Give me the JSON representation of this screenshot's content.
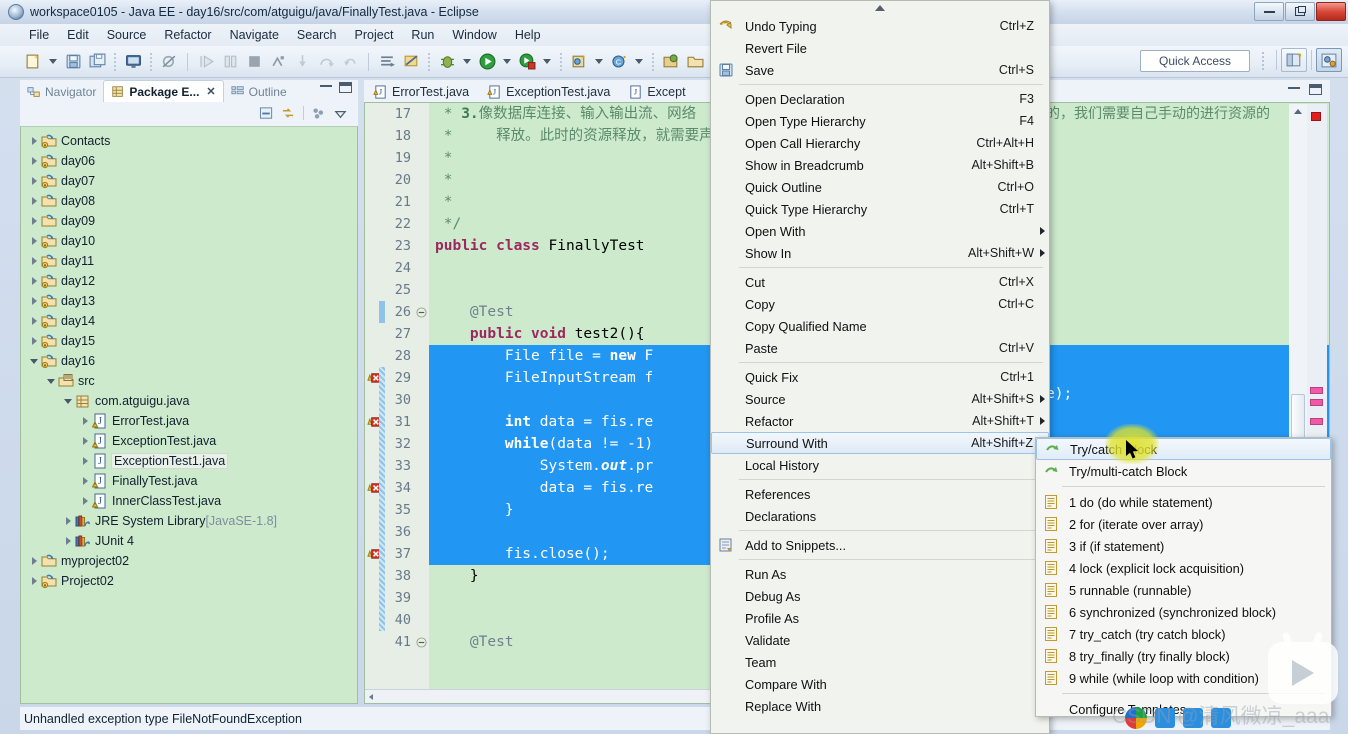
{
  "window": {
    "title": "workspace0105 - Java EE - day16/src/com/atguigu/java/FinallyTest.java - Eclipse",
    "icon": "eclipse-icon",
    "controls": {
      "minimize": "minimize-button",
      "maximize": "maximize-button",
      "close": "close-button"
    }
  },
  "menubar": {
    "items": [
      "File",
      "Edit",
      "Source",
      "Refactor",
      "Navigate",
      "Search",
      "Project",
      "Run",
      "Window",
      "Help"
    ]
  },
  "toolbar": {
    "quick_access_placeholder": "Quick Access",
    "quick_access_value": "Quick Access"
  },
  "left_view": {
    "tabs": [
      {
        "label": "Navigator",
        "icon": "navigator-icon",
        "active": false,
        "closable": false
      },
      {
        "label": "Package E...",
        "icon": "package-explorer-icon",
        "active": true,
        "closable": true
      },
      {
        "label": "Outline",
        "icon": "outline-icon",
        "active": false,
        "closable": false
      }
    ],
    "tree": [
      {
        "label": "Contacts",
        "icon": "java-project-icon",
        "depth": 0,
        "state": "collapsed",
        "selected": false
      },
      {
        "label": "day06",
        "icon": "java-project-icon",
        "depth": 0,
        "state": "collapsed",
        "selected": false
      },
      {
        "label": "day07",
        "icon": "java-project-icon",
        "depth": 0,
        "state": "collapsed",
        "selected": false
      },
      {
        "label": "day08",
        "icon": "plain-project-icon",
        "depth": 0,
        "state": "collapsed",
        "selected": false
      },
      {
        "label": "day09",
        "icon": "plain-project-icon",
        "depth": 0,
        "state": "collapsed",
        "selected": false
      },
      {
        "label": "day10",
        "icon": "java-project-icon",
        "depth": 0,
        "state": "collapsed",
        "selected": false
      },
      {
        "label": "day11",
        "icon": "java-project-icon",
        "depth": 0,
        "state": "collapsed",
        "selected": false
      },
      {
        "label": "day12",
        "icon": "java-project-icon",
        "depth": 0,
        "state": "collapsed",
        "selected": false
      },
      {
        "label": "day13",
        "icon": "java-project-icon",
        "depth": 0,
        "state": "collapsed",
        "selected": false
      },
      {
        "label": "day14",
        "icon": "java-project-icon",
        "depth": 0,
        "state": "collapsed",
        "selected": false
      },
      {
        "label": "day15",
        "icon": "java-project-icon",
        "depth": 0,
        "state": "collapsed",
        "selected": false
      },
      {
        "label": "day16",
        "icon": "java-project-icon",
        "depth": 0,
        "state": "expanded",
        "selected": false
      },
      {
        "label": "src",
        "icon": "source-folder-icon",
        "depth": 1,
        "state": "expanded",
        "selected": false
      },
      {
        "label": "com.atguigu.java",
        "icon": "package-icon",
        "depth": 2,
        "state": "expanded",
        "selected": false
      },
      {
        "label": "ErrorTest.java",
        "icon": "java-file-warn-icon",
        "depth": 3,
        "state": "collapsed",
        "selected": false
      },
      {
        "label": "ExceptionTest.java",
        "icon": "java-file-warn-icon",
        "depth": 3,
        "state": "collapsed",
        "selected": false
      },
      {
        "label": "ExceptionTest1.java",
        "icon": "java-file-icon",
        "depth": 3,
        "state": "collapsed",
        "selected": true
      },
      {
        "label": "FinallyTest.java",
        "icon": "java-file-warn-icon",
        "depth": 3,
        "state": "collapsed",
        "selected": false
      },
      {
        "label": "InnerClassTest.java",
        "icon": "java-file-warn-icon",
        "depth": 3,
        "state": "collapsed",
        "selected": false
      },
      {
        "label": "JRE System Library",
        "suffix": "[JavaSE-1.8]",
        "icon": "library-icon",
        "depth": 2,
        "state": "collapsed",
        "selected": false
      },
      {
        "label": "JUnit 4",
        "icon": "library-icon",
        "depth": 2,
        "state": "collapsed",
        "selected": false
      },
      {
        "label": "myproject02",
        "icon": "plain-project-icon",
        "depth": 0,
        "state": "collapsed",
        "selected": false
      },
      {
        "label": "Project02",
        "icon": "java-project-icon",
        "depth": 0,
        "state": "collapsed",
        "selected": false
      }
    ]
  },
  "editor": {
    "tabs": [
      {
        "label": "ErrorTest.java",
        "icon": "java-file-warn-icon",
        "active": false
      },
      {
        "label": "ExceptionTest.java",
        "icon": "java-file-warn-icon",
        "active": false
      },
      {
        "label": "Except",
        "icon": "java-file-icon",
        "active": false
      }
    ],
    "first_line_number": 17,
    "lines": [
      {
        "n": 17,
        "marker": null,
        "fold": null,
        "segments": [
          {
            "t": " * ",
            "c": "cmt"
          },
          {
            "t": "3.",
            "c": "cmt-b"
          },
          {
            "t": "像数据库连接、输入输出流、网络",
            "c": "cmt"
          }
        ]
      },
      {
        "n": 18,
        "marker": null,
        "fold": null,
        "segments": [
          {
            "t": " *     释放。此时的资源释放，就需要声",
            "c": "cmt"
          }
        ]
      },
      {
        "n": 19,
        "marker": null,
        "fold": null,
        "segments": [
          {
            "t": " *",
            "c": "cmt"
          }
        ]
      },
      {
        "n": 20,
        "marker": null,
        "fold": null,
        "segments": [
          {
            "t": " *",
            "c": "cmt"
          }
        ]
      },
      {
        "n": 21,
        "marker": null,
        "fold": null,
        "segments": [
          {
            "t": " *",
            "c": "cmt"
          }
        ]
      },
      {
        "n": 22,
        "marker": null,
        "fold": null,
        "segments": [
          {
            "t": " */",
            "c": "cmt"
          }
        ]
      },
      {
        "n": 23,
        "marker": null,
        "fold": null,
        "segments": [
          {
            "t": "public class ",
            "c": "kw"
          },
          {
            "t": "FinallyTest",
            "c": "plain"
          }
        ]
      },
      {
        "n": 24,
        "marker": null,
        "fold": null,
        "segments": []
      },
      {
        "n": 25,
        "marker": null,
        "fold": null,
        "segments": []
      },
      {
        "n": 26,
        "marker": null,
        "fold": "collapse",
        "segments": [
          {
            "t": "    @Test",
            "c": "ann"
          }
        ]
      },
      {
        "n": 27,
        "marker": null,
        "fold": null,
        "segments": [
          {
            "t": "    ",
            "c": "plain"
          },
          {
            "t": "public void ",
            "c": "kw"
          },
          {
            "t": "test2(){",
            "c": "plain"
          }
        ]
      },
      {
        "n": 28,
        "marker": null,
        "fold": null,
        "selected": true,
        "segments": [
          {
            "t": "        File file = ",
            "c": "sel"
          },
          {
            "t": "new ",
            "c": "sel-kw"
          },
          {
            "t": "F",
            "c": "sel"
          }
        ]
      },
      {
        "n": 29,
        "marker": "error",
        "fold": null,
        "selected": true,
        "segments": [
          {
            "t": "        FileInputStream f",
            "c": "sel"
          }
        ]
      },
      {
        "n": 30,
        "marker": null,
        "fold": null,
        "selected": true,
        "segments": []
      },
      {
        "n": 31,
        "marker": "error",
        "fold": null,
        "selected": true,
        "segments": [
          {
            "t": "        ",
            "c": "sel"
          },
          {
            "t": "int ",
            "c": "sel-kw"
          },
          {
            "t": "data = fis.re",
            "c": "sel"
          }
        ]
      },
      {
        "n": 32,
        "marker": null,
        "fold": null,
        "selected": true,
        "segments": [
          {
            "t": "        ",
            "c": "sel"
          },
          {
            "t": "while",
            "c": "sel-kw"
          },
          {
            "t": "(data != -1)",
            "c": "sel"
          }
        ]
      },
      {
        "n": 33,
        "marker": null,
        "fold": null,
        "selected": true,
        "segments": [
          {
            "t": "            System.",
            "c": "sel"
          },
          {
            "t": "out",
            "c": "sel-fld"
          },
          {
            "t": ".pr",
            "c": "sel"
          }
        ]
      },
      {
        "n": 34,
        "marker": "error",
        "fold": null,
        "selected": true,
        "segments": [
          {
            "t": "            data = fis.re",
            "c": "sel"
          }
        ]
      },
      {
        "n": 35,
        "marker": null,
        "fold": null,
        "selected": true,
        "segments": [
          {
            "t": "        }",
            "c": "sel"
          }
        ]
      },
      {
        "n": 36,
        "marker": null,
        "fold": null,
        "selected": true,
        "segments": []
      },
      {
        "n": 37,
        "marker": "error",
        "fold": null,
        "selected": true,
        "segments": [
          {
            "t": "        fis.close();",
            "c": "sel"
          }
        ]
      },
      {
        "n": 38,
        "marker": null,
        "fold": null,
        "segments": [
          {
            "t": "    }",
            "c": "plain"
          }
        ]
      },
      {
        "n": 39,
        "marker": null,
        "fold": null,
        "segments": []
      },
      {
        "n": 40,
        "marker": null,
        "fold": null,
        "segments": []
      },
      {
        "n": 41,
        "marker": null,
        "fold": "collapse",
        "segments": [
          {
            "t": "    @Test",
            "c": "ann"
          }
        ]
      }
    ],
    "right_visible_comment": "的，我们需要自己手动的进行资源的",
    "right_visible_code": "e);"
  },
  "statusbar": {
    "message": "Unhandled exception type FileNotFoundException"
  },
  "context_menu": {
    "groups": [
      [
        {
          "label": "Undo Typing",
          "key": "Ctrl+Z",
          "icon": "undo-icon",
          "submenu": false
        },
        {
          "label": "Revert File",
          "key": "",
          "icon": null,
          "submenu": false
        },
        {
          "label": "Save",
          "key": "Ctrl+S",
          "icon": "save-icon",
          "submenu": false
        }
      ],
      [
        {
          "label": "Open Declaration",
          "key": "F3",
          "icon": null,
          "submenu": false
        },
        {
          "label": "Open Type Hierarchy",
          "key": "F4",
          "icon": null,
          "submenu": false
        },
        {
          "label": "Open Call Hierarchy",
          "key": "Ctrl+Alt+H",
          "icon": null,
          "submenu": false
        },
        {
          "label": "Show in Breadcrumb",
          "key": "Alt+Shift+B",
          "icon": null,
          "submenu": false
        },
        {
          "label": "Quick Outline",
          "key": "Ctrl+O",
          "icon": null,
          "submenu": false
        },
        {
          "label": "Quick Type Hierarchy",
          "key": "Ctrl+T",
          "icon": null,
          "submenu": false
        },
        {
          "label": "Open With",
          "key": "",
          "icon": null,
          "submenu": true
        },
        {
          "label": "Show In",
          "key": "Alt+Shift+W",
          "icon": null,
          "submenu": true
        }
      ],
      [
        {
          "label": "Cut",
          "key": "Ctrl+X",
          "icon": null,
          "submenu": false
        },
        {
          "label": "Copy",
          "key": "Ctrl+C",
          "icon": null,
          "submenu": false
        },
        {
          "label": "Copy Qualified Name",
          "key": "",
          "icon": null,
          "submenu": false
        },
        {
          "label": "Paste",
          "key": "Ctrl+V",
          "icon": null,
          "submenu": false
        }
      ],
      [
        {
          "label": "Quick Fix",
          "key": "Ctrl+1",
          "icon": null,
          "submenu": false
        },
        {
          "label": "Source",
          "key": "Alt+Shift+S",
          "icon": null,
          "submenu": true
        },
        {
          "label": "Refactor",
          "key": "Alt+Shift+T",
          "icon": null,
          "submenu": true
        },
        {
          "label": "Surround With",
          "key": "Alt+Shift+Z",
          "icon": null,
          "submenu": true,
          "highlighted": true
        },
        {
          "label": "Local History",
          "key": "",
          "icon": null,
          "submenu": true
        }
      ],
      [
        {
          "label": "References",
          "key": "",
          "icon": null,
          "submenu": true
        },
        {
          "label": "Declarations",
          "key": "",
          "icon": null,
          "submenu": true
        }
      ],
      [
        {
          "label": "Add to Snippets...",
          "key": "",
          "icon": "snippets-icon",
          "submenu": false
        }
      ],
      [
        {
          "label": "Run As",
          "key": "",
          "icon": null,
          "submenu": true
        },
        {
          "label": "Debug As",
          "key": "",
          "icon": null,
          "submenu": true
        },
        {
          "label": "Profile As",
          "key": "",
          "icon": null,
          "submenu": true
        },
        {
          "label": "Validate",
          "key": "",
          "icon": null,
          "submenu": false
        },
        {
          "label": "Team",
          "key": "",
          "icon": null,
          "submenu": true
        },
        {
          "label": "Compare With",
          "key": "",
          "icon": null,
          "submenu": true
        },
        {
          "label": "Replace With",
          "key": "",
          "icon": null,
          "submenu": true
        }
      ]
    ]
  },
  "submenu": {
    "title": "Surround With",
    "groups": [
      [
        {
          "label": "Try/catch Block",
          "icon": "quickfix-icon",
          "highlighted": true
        },
        {
          "label": "Try/multi-catch Block",
          "icon": "quickfix-icon",
          "highlighted": false
        }
      ],
      [
        {
          "label": "1 do (do while statement)",
          "icon": "template-icon",
          "highlighted": false
        },
        {
          "label": "2 for (iterate over array)",
          "icon": "template-icon",
          "highlighted": false
        },
        {
          "label": "3 if (if statement)",
          "icon": "template-icon",
          "highlighted": false
        },
        {
          "label": "4 lock (explicit lock acquisition)",
          "icon": "template-icon",
          "highlighted": false
        },
        {
          "label": "5 runnable (runnable)",
          "icon": "template-icon",
          "highlighted": false
        },
        {
          "label": "6 synchronized (synchronized block)",
          "icon": "template-icon",
          "highlighted": false
        },
        {
          "label": "7 try_catch (try catch block)",
          "icon": "template-icon",
          "highlighted": false
        },
        {
          "label": "8 try_finally (try finally block)",
          "icon": "template-icon",
          "highlighted": false
        },
        {
          "label": "9 while (while loop with condition)",
          "icon": "template-icon",
          "highlighted": false
        }
      ],
      [
        {
          "label": "Configure Templates...",
          "icon": null,
          "highlighted": false
        }
      ]
    ]
  },
  "watermark": {
    "text": "CSDN @清风微凉_aaa"
  },
  "colors": {
    "editor_background": "#cdeacd",
    "selection_blue": "#2196f3",
    "keyword_magenta": "#9c2761",
    "comment_green": "#5b8a6b",
    "menu_background": "#f1f3ef",
    "highlight_blue": "#dfeaf6",
    "cursor_highlight_yellow": "#dfe22c"
  }
}
